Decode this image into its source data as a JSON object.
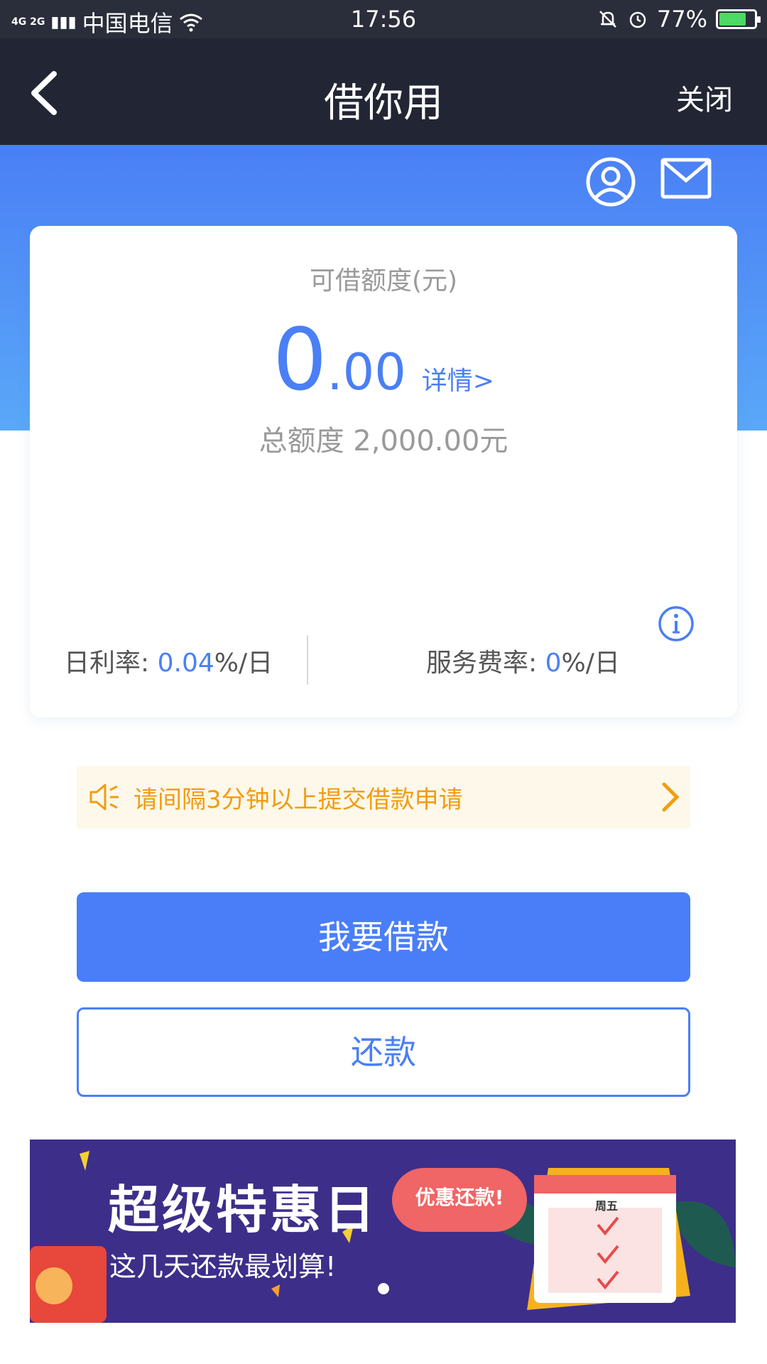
{
  "status_bar": {
    "network": "4G 2G",
    "carrier": "中国电信",
    "time": "17:56",
    "battery": "77%",
    "battery_level": 0.77
  },
  "nav": {
    "title": "借你用",
    "close_label": "关闭"
  },
  "card": {
    "available_label": "可借额度(元)",
    "amount_integer": "0",
    "amount_decimal": ".00",
    "detail_link": "详情>",
    "total_label": "总额度 2,000.00元",
    "daily_rate_label": "日利率:",
    "daily_rate_value": "0.04",
    "daily_rate_unit": "%/日",
    "service_rate_label": "服务费率:",
    "service_rate_value": "0",
    "service_rate_unit": "%/日"
  },
  "notice": {
    "text": "请间隔3分钟以上提交借款申请"
  },
  "actions": {
    "borrow_label": "我要借款",
    "repay_label": "还款"
  },
  "banner": {
    "title": "超级特惠日",
    "subtitle": "这几天还款最划算!",
    "tag": "优惠还款!",
    "calendar_label": "周五"
  },
  "colors": {
    "accent": "#4a7ff5",
    "nav_bg": "#222634",
    "notice_text": "#f39c12",
    "banner_bg": "#3d2e8a"
  }
}
